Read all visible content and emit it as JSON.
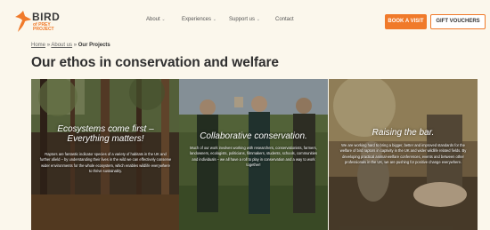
{
  "logo": {
    "line1": "BIRD",
    "line2": "of PREY PROJECT"
  },
  "nav": [
    {
      "label": "About",
      "chevron": "⌄"
    },
    {
      "label": "Experiences",
      "chevron": "⌄"
    },
    {
      "label": "Support us",
      "chevron": "⌄"
    },
    {
      "label": "Contact",
      "chevron": ""
    }
  ],
  "buttons": {
    "visit": "BOOK A VISIT",
    "gift": "GIFT VOUCHERS"
  },
  "breadcrumb": {
    "home": "Home",
    "sep1": "»",
    "about": "About us",
    "sep2": "»",
    "current": "Our Projects"
  },
  "page": {
    "title": "Our ethos in conservation and welfare"
  },
  "cards": [
    {
      "heading": "Ecosystems come first – Everything matters!",
      "body": "Raptors are fantastic indicator species of a variety of habitats in the UK and further afield – by understanding their lives in the wild we can effectively conserve wider environments for the whole ecosystem, which enables wildlife everywhere to thrive sustainably."
    },
    {
      "heading": "Collaborative conservation.",
      "body": "Much of our work involves working with researchers, conservationists, farmers, landowners, ecologists, politicians, filmmakers, students, schools, communities and individuals – we all have a roll to play in conservation and a way to work together!"
    },
    {
      "heading": "Raising the bar.",
      "body": "We are working hard to bring a bigger, better and improved standards for the welfare of bird raptors in captivity in the UK and wider wildlife related fields. By developing practical animal-welfare conferences, events and between other professionals in the UK, we are pushing for positive change everywhere."
    }
  ],
  "colors": {
    "accent": "#f07a2a",
    "background": "#fbf7ec",
    "title": "#2f2f2f"
  },
  "icons": {
    "logo": "bird-silhouette-icon"
  }
}
